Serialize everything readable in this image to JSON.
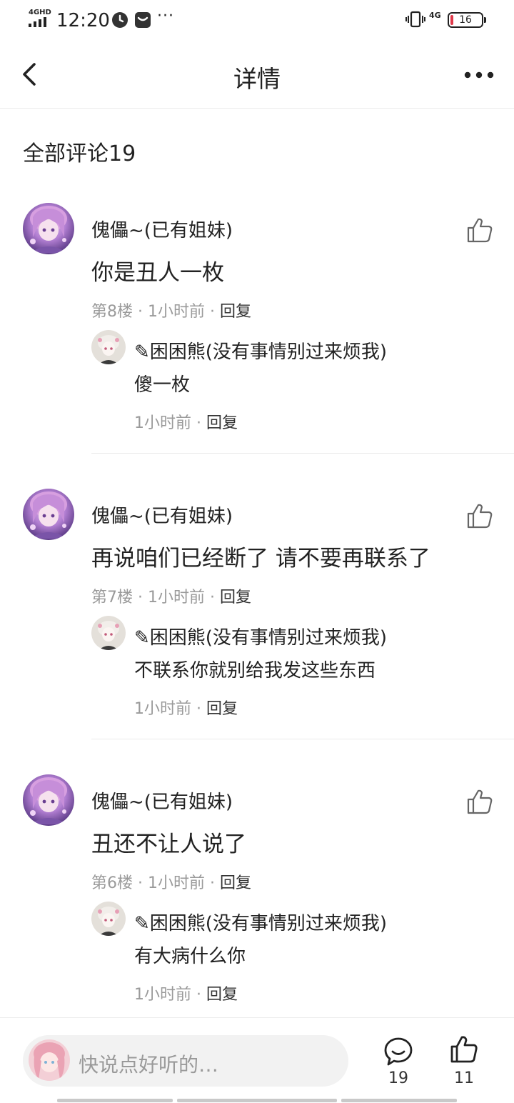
{
  "status_bar": {
    "network": "4GHD",
    "time": "12:20",
    "dots": "···",
    "network_right": "4G",
    "battery": "16",
    "icons": [
      "signal-icon",
      "clock-icon",
      "message-icon",
      "vibrate-icon",
      "battery-icon"
    ]
  },
  "nav": {
    "title": "详情",
    "icons": [
      "back-arrow-icon",
      "more-icon"
    ]
  },
  "section": {
    "title": "全部评论19"
  },
  "comments": [
    {
      "user": "傀儡~(已有姐妹)",
      "text": "你是丑人一枚",
      "floor": "第8楼",
      "time": "1小时前",
      "reply_label": "回复",
      "reply": {
        "user": "✎困困熊(没有事情别过来烦我)",
        "text": "傻一枚",
        "time": "1小时前",
        "reply_label": "回复"
      }
    },
    {
      "user": "傀儡~(已有姐妹)",
      "text": "再说咱们已经断了 请不要再联系了",
      "floor": "第7楼",
      "time": "1小时前",
      "reply_label": "回复",
      "reply": {
        "user": "✎困困熊(没有事情别过来烦我)",
        "text": "不联系你就别给我发这些东西",
        "time": "1小时前",
        "reply_label": "回复"
      }
    },
    {
      "user": "傀儡~(已有姐妹)",
      "text": "丑还不让人说了",
      "floor": "第6楼",
      "time": "1小时前",
      "reply_label": "回复",
      "reply": {
        "user": "✎困困熊(没有事情别过来烦我)",
        "text": "有大病什么你",
        "time": "1小时前",
        "reply_label": "回复"
      }
    }
  ],
  "separator": "·",
  "bottom_bar": {
    "placeholder": "快说点好听的…",
    "comment_count": "19",
    "like_count": "11",
    "icons": [
      "comment-icon",
      "like-icon"
    ]
  },
  "colors": {
    "avatar_main": "#8a63b8",
    "avatar_reply": "#d8d3cc",
    "meta_gray": "#9a9a9a",
    "battery_low": "#e0394a"
  }
}
